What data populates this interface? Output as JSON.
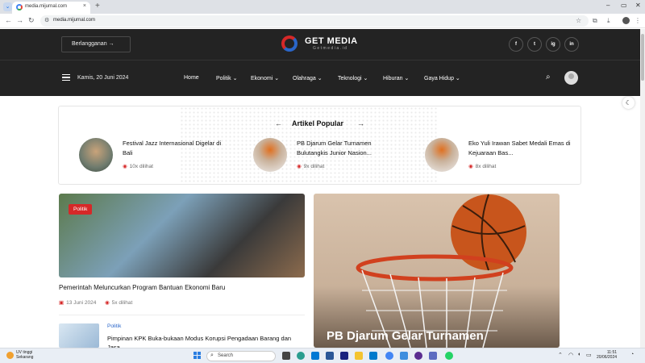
{
  "browser": {
    "tab_title": "media.mijurnal.com",
    "url": "media.mijurnal.com",
    "new_tab": "+",
    "tab_close": "×"
  },
  "header": {
    "subscribe_label": "Berlangganan",
    "logo_text": "GET MEDIA",
    "logo_sub": "Getmedia.id",
    "social": [
      "f",
      "t",
      "ig",
      "in"
    ]
  },
  "nav": {
    "date": "Kamis, 20 Juni 2024",
    "items": [
      {
        "label": "Home"
      },
      {
        "label": "Politik"
      },
      {
        "label": "Ekonomi"
      },
      {
        "label": "Olahraga"
      },
      {
        "label": "Teknologi"
      },
      {
        "label": "Hiburan"
      },
      {
        "label": "Gaya Hidup"
      }
    ]
  },
  "popular": {
    "title": "Artikel Popular",
    "items": [
      {
        "title": "Festival Jazz Internasional Digelar di Bali",
        "views": "10x dilihat"
      },
      {
        "title": "PB Djarum Gelar Turnamen Bulutangkis Junior Nasion...",
        "views": "9x dilihat"
      },
      {
        "title": "Eko Yuli Irawan Sabet Medali Emas di Kejuaraan Bas...",
        "views": "8x dilihat"
      }
    ]
  },
  "articles": {
    "main": {
      "tag": "Politik",
      "title": "Pemerintah Meluncurkan Program Bantuan Ekonomi Baru",
      "date": "13 Juni 2024",
      "views": "5x dilihat"
    },
    "small": {
      "category": "Politik",
      "title": "Pimpinan KPK Buka-bukaan Modus Korupsi Pengadaan Barang dan Jasa"
    },
    "feature": {
      "title": "PB Djarum Gelar Turnamen"
    }
  },
  "taskbar": {
    "weather_title": "UV tinggi",
    "weather_sub": "Sekarang",
    "search_placeholder": "Search",
    "time": "11:51",
    "date": "20/06/2024"
  },
  "colors": {
    "accent": "#d62828",
    "header_bg": "#232323"
  }
}
